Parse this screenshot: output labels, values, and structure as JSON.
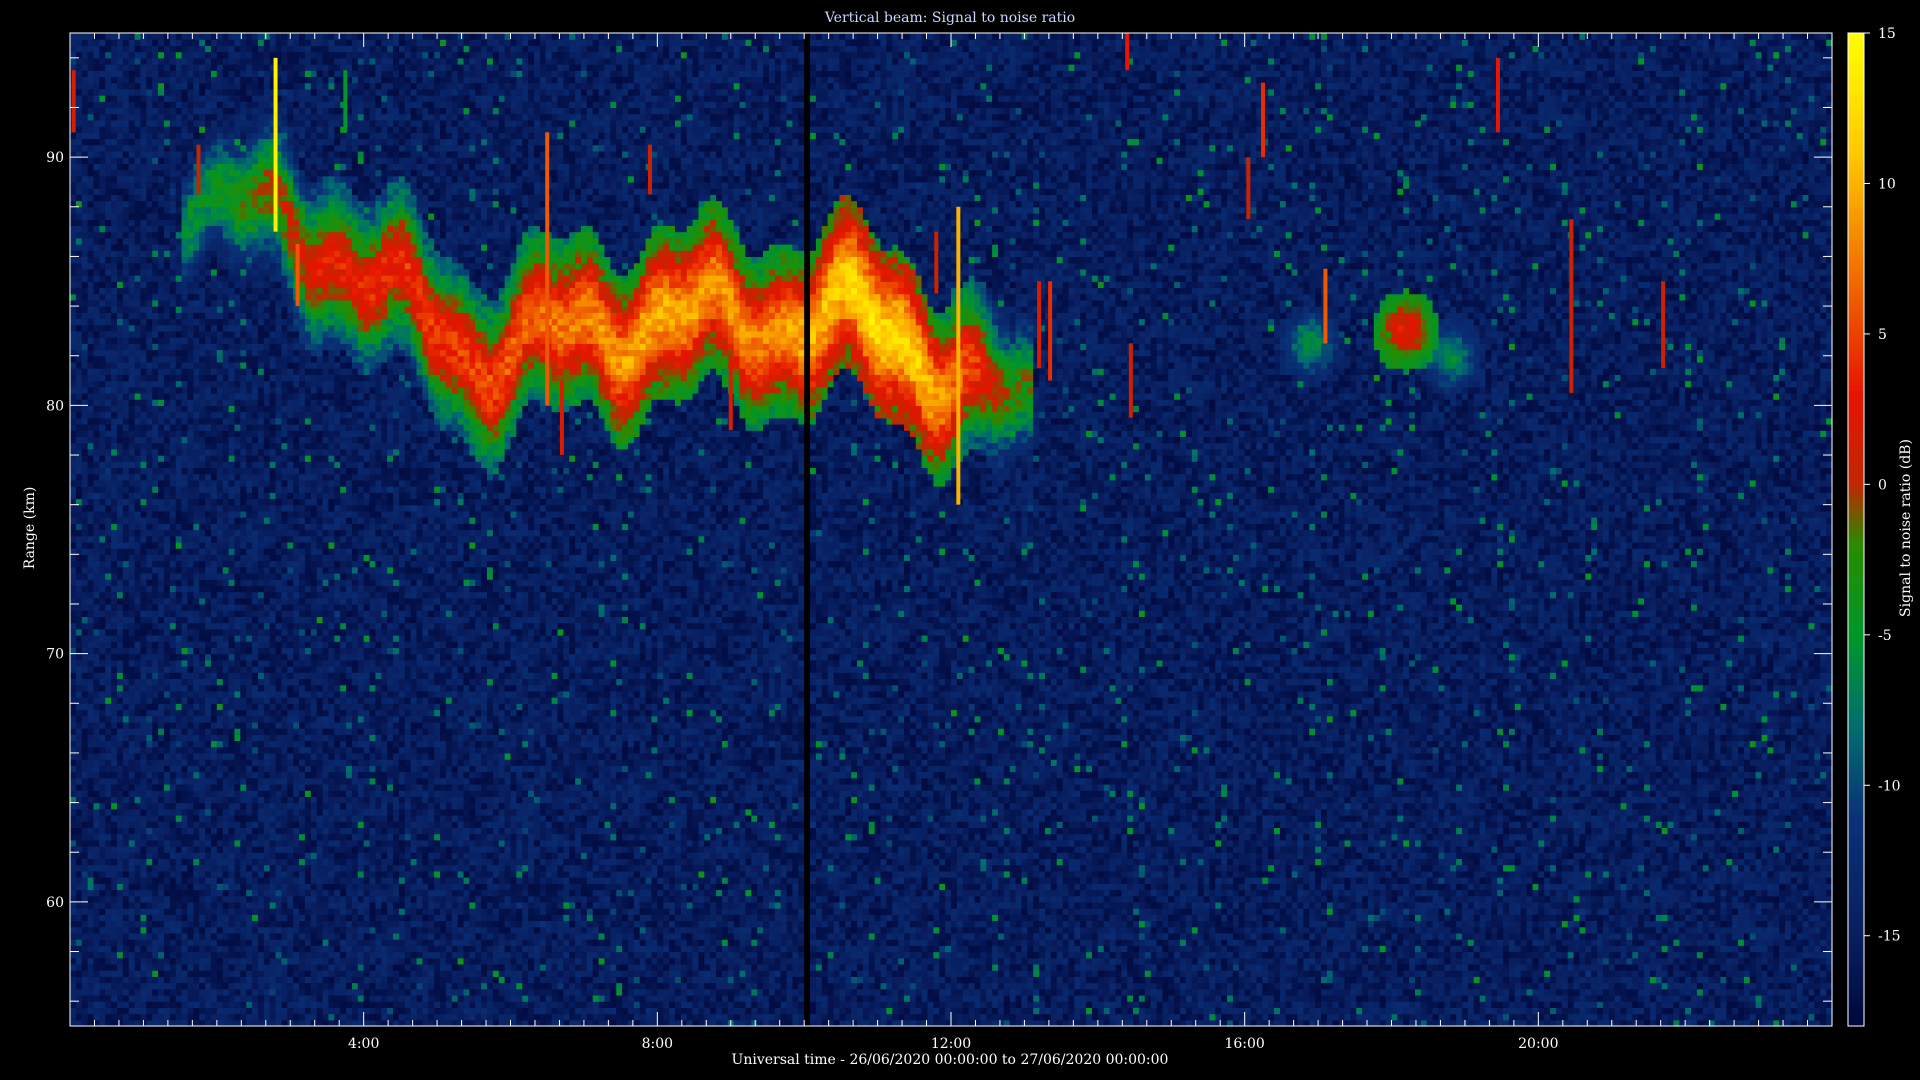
{
  "chart_data": {
    "type": "heatmap",
    "title": "Vertical beam: Signal to noise ratio",
    "xlabel": "Universal time - 26/06/2020 00:00:00 to 27/06/2020 00:00:00",
    "ylabel": "Range (km)",
    "colorbar_label": "Signal to noise ratio (dB)",
    "xlim_hours": [
      0,
      24
    ],
    "ylim_km": [
      55,
      95
    ],
    "x_ticks": [
      {
        "value": 4,
        "label": "4:00"
      },
      {
        "value": 8,
        "label": "8:00"
      },
      {
        "value": 12,
        "label": "12:00"
      },
      {
        "value": 16,
        "label": "16:00"
      },
      {
        "value": 20,
        "label": "20:00"
      }
    ],
    "y_ticks": [
      {
        "value": 60,
        "label": "60"
      },
      {
        "value": 70,
        "label": "70"
      },
      {
        "value": 80,
        "label": "80"
      },
      {
        "value": 90,
        "label": "90"
      }
    ],
    "colorbar_range_db": [
      -18,
      15
    ],
    "colorbar_ticks": [
      {
        "value": 15,
        "label": "15"
      },
      {
        "value": 10,
        "label": "10"
      },
      {
        "value": 5,
        "label": "5"
      },
      {
        "value": 0,
        "label": "0"
      },
      {
        "value": -5,
        "label": "-5"
      },
      {
        "value": -10,
        "label": "-10"
      },
      {
        "value": -15,
        "label": "-15"
      }
    ],
    "background_snr_db": -15,
    "data_gap_hour": 10.05,
    "echo_layer": {
      "description_points": [
        {
          "hour": 1.8,
          "range_km": 88.5,
          "snr_db": -5
        },
        {
          "hour": 3.5,
          "range_km": 86.5,
          "snr_db": 3
        },
        {
          "hour": 5.5,
          "range_km": 82.0,
          "snr_db": 5
        },
        {
          "hour": 7.0,
          "range_km": 83.0,
          "snr_db": 8
        },
        {
          "hour": 8.0,
          "range_km": 83.5,
          "snr_db": 10
        },
        {
          "hour": 9.5,
          "range_km": 83.5,
          "snr_db": 8
        },
        {
          "hour": 10.8,
          "range_km": 83.5,
          "snr_db": 13
        },
        {
          "hour": 11.5,
          "range_km": 82.5,
          "snr_db": 12
        },
        {
          "hour": 12.4,
          "range_km": 80.5,
          "snr_db": 4
        },
        {
          "hour": 12.8,
          "range_km": 80.0,
          "snr_db": -2
        }
      ],
      "late_patches": [
        {
          "hour": 16.9,
          "range_km": 82.5,
          "snr_db": -6
        },
        {
          "hour": 18.2,
          "range_km": 83.0,
          "snr_db": 3
        },
        {
          "hour": 18.8,
          "range_km": 82.0,
          "snr_db": -6
        }
      ]
    },
    "spikes": [
      {
        "hour": 2.8,
        "range_lo": 87.0,
        "range_hi": 94.0,
        "snr_db": 14
      },
      {
        "hour": 6.5,
        "range_lo": 80.0,
        "range_hi": 91.0,
        "snr_db": 6
      },
      {
        "hour": 12.1,
        "range_lo": 76.0,
        "range_hi": 88.0,
        "snr_db": 10
      },
      {
        "hour": 1.75,
        "range_lo": 88.5,
        "range_hi": 90.5,
        "snr_db": 0
      },
      {
        "hour": 3.75,
        "range_lo": 91.0,
        "range_hi": 93.5,
        "snr_db": -5
      },
      {
        "hour": 7.9,
        "range_lo": 88.5,
        "range_hi": 90.5,
        "snr_db": 1
      },
      {
        "hour": 14.4,
        "range_lo": 93.5,
        "range_hi": 95.0,
        "snr_db": 3
      },
      {
        "hour": 16.25,
        "range_lo": 90.0,
        "range_hi": 93.0,
        "snr_db": 4
      },
      {
        "hour": 16.05,
        "range_lo": 87.5,
        "range_hi": 90.0,
        "snr_db": 1
      },
      {
        "hour": 19.45,
        "range_lo": 91.0,
        "range_hi": 94.0,
        "snr_db": 3
      },
      {
        "hour": 20.45,
        "range_lo": 80.5,
        "range_hi": 87.5,
        "snr_db": 1
      },
      {
        "hour": 13.2,
        "range_lo": 81.5,
        "range_hi": 85.0,
        "snr_db": 2
      },
      {
        "hour": 13.35,
        "range_lo": 81.0,
        "range_hi": 85.0,
        "snr_db": 4
      },
      {
        "hour": 17.1,
        "range_lo": 82.5,
        "range_hi": 85.5,
        "snr_db": 6
      },
      {
        "hour": 0.05,
        "range_lo": 91.0,
        "range_hi": 93.5,
        "snr_db": 2
      },
      {
        "hour": 6.7,
        "range_lo": 78.0,
        "range_hi": 81.0,
        "snr_db": 2
      },
      {
        "hour": 9.0,
        "range_lo": 79.0,
        "range_hi": 82.0,
        "snr_db": 2
      },
      {
        "hour": 11.8,
        "range_lo": 84.5,
        "range_hi": 87.0,
        "snr_db": 1
      },
      {
        "hour": 21.7,
        "range_lo": 81.5,
        "range_hi": 85.0,
        "snr_db": 1
      },
      {
        "hour": 14.45,
        "range_lo": 79.5,
        "range_hi": 82.5,
        "snr_db": 1
      },
      {
        "hour": 3.1,
        "range_lo": 84.0,
        "range_hi": 86.5,
        "snr_db": 6
      }
    ],
    "grid": false,
    "colormap": "blue-green-red-yellow"
  }
}
